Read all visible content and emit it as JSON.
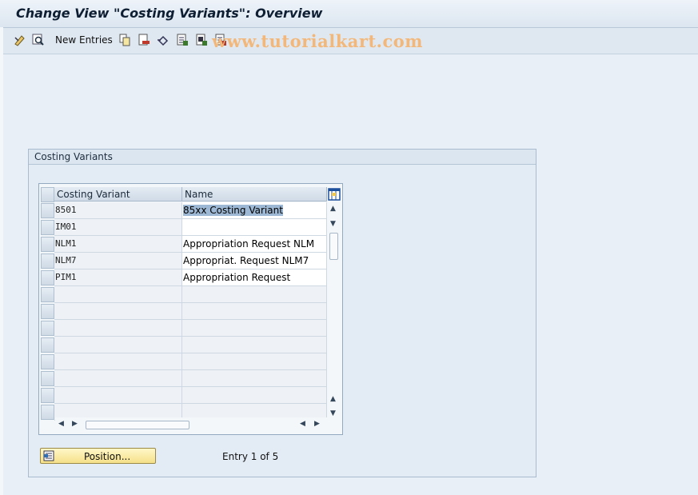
{
  "window": {
    "title": "Change View \"Costing Variants\": Overview"
  },
  "toolbar": {
    "new_entries_label": "New Entries",
    "icons": [
      "display-change-icon",
      "find-icon",
      "copy-icon",
      "delete-icon",
      "undo-icon",
      "select-all-icon",
      "select-block-icon",
      "deselect-all-icon"
    ]
  },
  "watermark": "www.tutorialkart.com",
  "group": {
    "title": "Costing Variants"
  },
  "table": {
    "columns": [
      "Costing Variant",
      "Name"
    ],
    "rows": [
      {
        "variant": "8501",
        "name": "85xx Costing Variant"
      },
      {
        "variant": "IM01",
        "name": ""
      },
      {
        "variant": "NLM1",
        "name": "Appropriation Request NLM"
      },
      {
        "variant": "NLM7",
        "name": "Appropriat. Request NLM7"
      },
      {
        "variant": "PIM1",
        "name": "Appropriation Request"
      }
    ]
  },
  "footer": {
    "position_label": "Position...",
    "entry_info": "Entry 1 of 5"
  }
}
